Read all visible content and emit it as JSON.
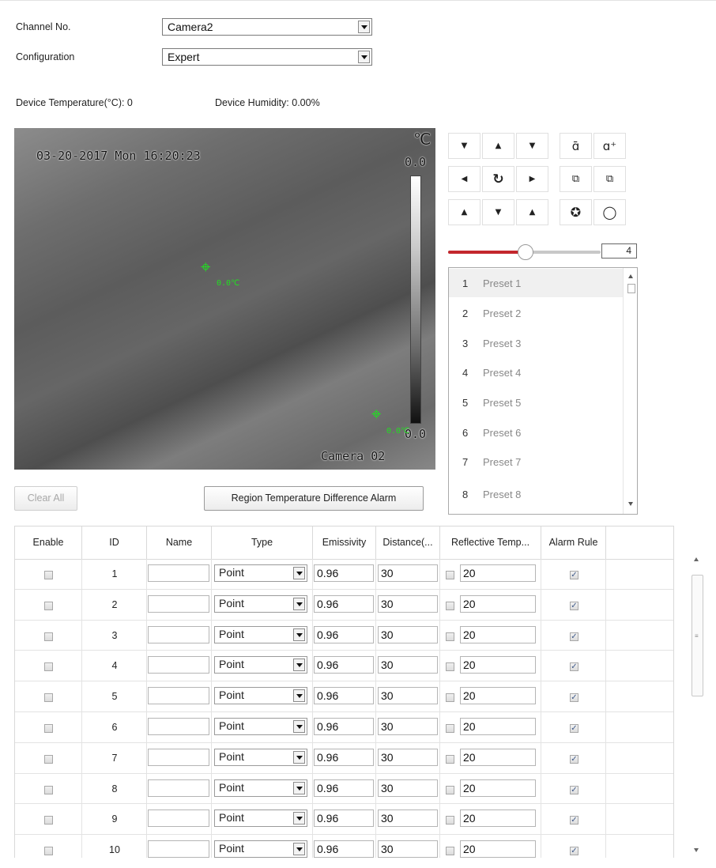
{
  "header": {
    "channel_label": "Channel No.",
    "channel_value": "Camera2",
    "config_label": "Configuration",
    "config_value": "Expert",
    "device_temperature": "Device Temperature(°C): 0",
    "device_humidity": "Device Humidity: 0.00%"
  },
  "video": {
    "timestamp": "03-20-2017 Mon 16:20:23",
    "unit": "℃",
    "scale_top": "0.0",
    "scale_bottom": "0.0",
    "point_temp_1": "0.0℃",
    "point_temp_2": "0.0℃",
    "camera_label": "Camera 02"
  },
  "ptz": {
    "icons": [
      "arrow-up-left-icon",
      "arrow-up-icon",
      "arrow-up-right-icon",
      "zoom-out-icon",
      "zoom-in-icon",
      "arrow-left-icon",
      "auto-pan-icon",
      "arrow-right-icon",
      "focus-near-icon",
      "focus-far-icon",
      "arrow-down-left-icon",
      "arrow-down-icon",
      "arrow-down-right-icon",
      "iris-close-icon",
      "iris-open-icon"
    ],
    "speed_value": "4",
    "speed_level": 0.45
  },
  "presets": [
    {
      "num": "1",
      "label": "Preset 1"
    },
    {
      "num": "2",
      "label": "Preset 2"
    },
    {
      "num": "3",
      "label": "Preset 3"
    },
    {
      "num": "4",
      "label": "Preset 4"
    },
    {
      "num": "5",
      "label": "Preset 5"
    },
    {
      "num": "6",
      "label": "Preset 6"
    },
    {
      "num": "7",
      "label": "Preset 7"
    },
    {
      "num": "8",
      "label": "Preset 8"
    }
  ],
  "buttons": {
    "clear_all": "Clear All",
    "region_alarm": "Region Temperature Difference Alarm"
  },
  "table": {
    "headers": [
      "Enable",
      "ID",
      "Name",
      "Type",
      "Emissivity",
      "Distance(...",
      "Reflective Temp...",
      "Alarm Rule"
    ],
    "rows": [
      {
        "id": "1",
        "type": "Point",
        "emissivity": "0.96",
        "distance": "30",
        "reflective": "20"
      },
      {
        "id": "2",
        "type": "Point",
        "emissivity": "0.96",
        "distance": "30",
        "reflective": "20"
      },
      {
        "id": "3",
        "type": "Point",
        "emissivity": "0.96",
        "distance": "30",
        "reflective": "20"
      },
      {
        "id": "4",
        "type": "Point",
        "emissivity": "0.96",
        "distance": "30",
        "reflective": "20"
      },
      {
        "id": "5",
        "type": "Point",
        "emissivity": "0.96",
        "distance": "30",
        "reflective": "20"
      },
      {
        "id": "6",
        "type": "Point",
        "emissivity": "0.96",
        "distance": "30",
        "reflective": "20"
      },
      {
        "id": "7",
        "type": "Point",
        "emissivity": "0.96",
        "distance": "30",
        "reflective": "20"
      },
      {
        "id": "8",
        "type": "Point",
        "emissivity": "0.96",
        "distance": "30",
        "reflective": "20"
      },
      {
        "id": "9",
        "type": "Point",
        "emissivity": "0.96",
        "distance": "30",
        "reflective": "20"
      },
      {
        "id": "10",
        "type": "Point",
        "emissivity": "0.96",
        "distance": "30",
        "reflective": "20"
      }
    ]
  },
  "colors": {
    "slider_fill": "#c3272d",
    "overlay_green": "#22dd22"
  }
}
